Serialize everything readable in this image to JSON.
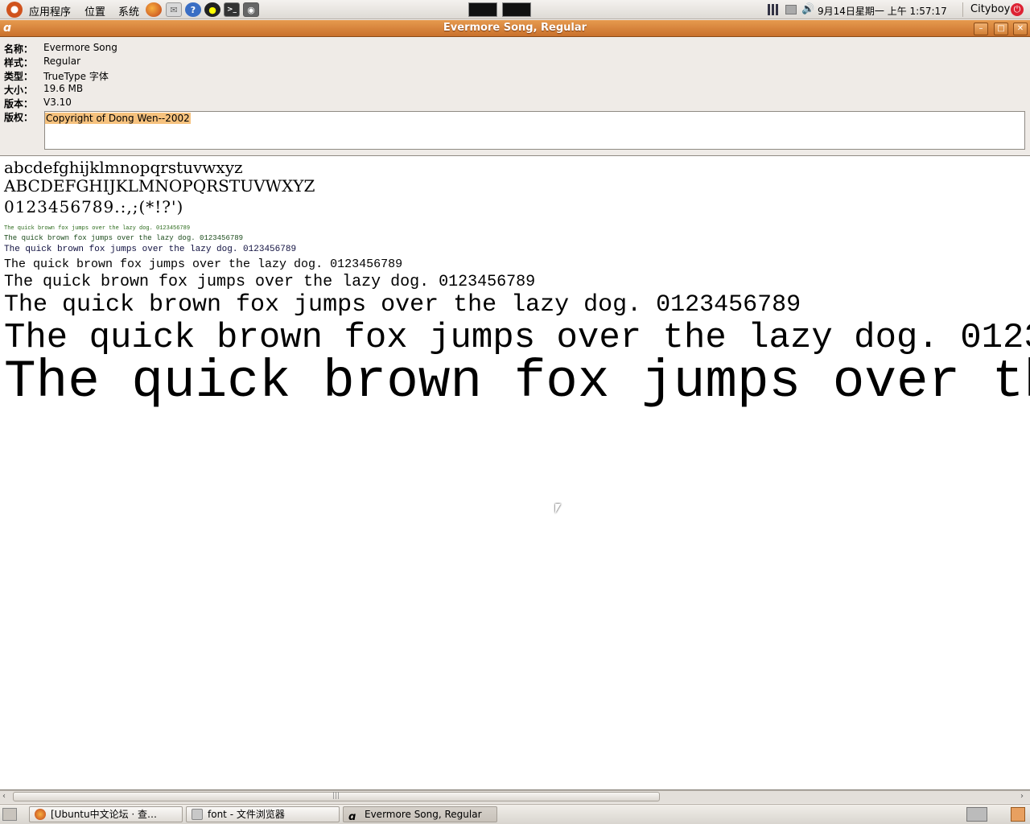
{
  "top_panel": {
    "menus": [
      "应用程序",
      "位置",
      "系统"
    ],
    "clock": "9月14日星期一 上午 1:57:17",
    "user": "Cityboy",
    "launchers": [
      "firefox-icon",
      "mail-icon",
      "help-icon",
      "qq-icon",
      "terminal-icon",
      "screenshot-icon"
    ]
  },
  "window": {
    "title": "Evermore Song, Regular",
    "controls": [
      "minimize",
      "maximize",
      "close"
    ]
  },
  "font_info": {
    "name_label": "名称：",
    "name_value": "Evermore Song",
    "style_label": "样式：",
    "style_value": "Regular",
    "type_label": "类型：",
    "type_value": "TrueType 字体",
    "size_label": "大小：",
    "size_value": "19.6 MB",
    "version_label": "版本：",
    "version_value": "V3.10",
    "copyright_label": "版权：",
    "copyright_value": "Copyright of Dong Wen--2002"
  },
  "preview": {
    "lowercase": "abcdefghijklmnopqrstuvwxyz",
    "uppercase": "ABCDEFGHIJKLMNOPQRSTUVWXYZ",
    "digits": "0123456789.:,;(*!?')",
    "sample": "The quick brown fox jumps over the lazy dog. 0123456789"
  },
  "taskbar": {
    "tasks": [
      {
        "label": "[Ubuntu中文论坛 · 查…",
        "active": false
      },
      {
        "label": "font - 文件浏览器",
        "active": false
      },
      {
        "label": "Evermore Song, Regular",
        "active": true
      }
    ]
  }
}
